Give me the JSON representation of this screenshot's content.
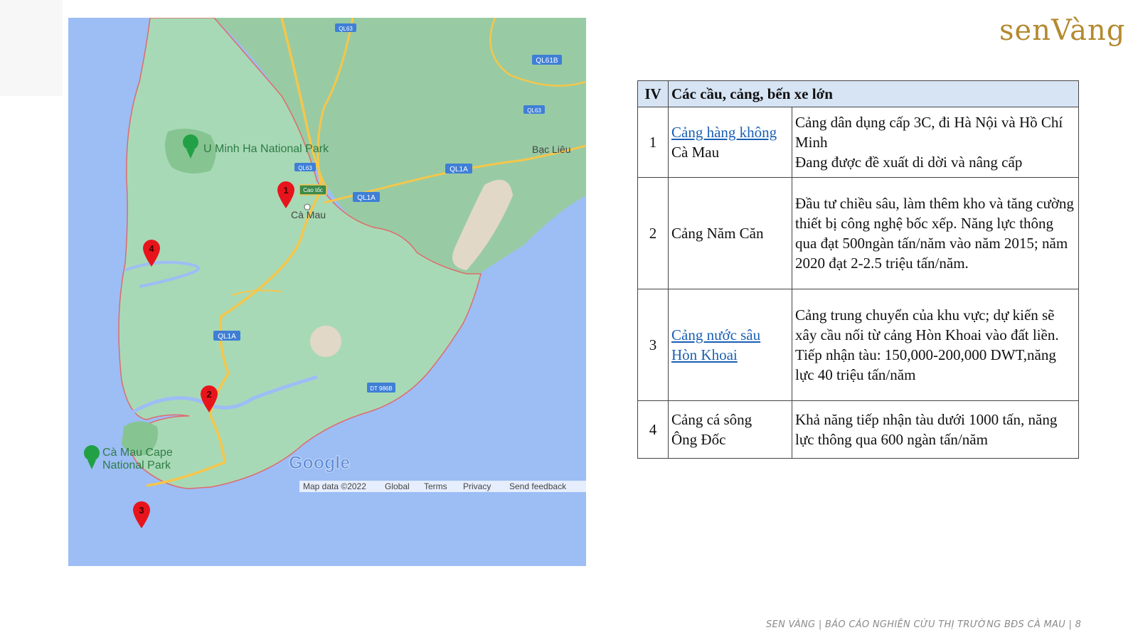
{
  "brand": {
    "name": "senVàng",
    "color": "#b38a2f"
  },
  "map": {
    "places": {
      "umh": "U Minh Ha National Park",
      "camau": "Cà Mau",
      "baclieu": "Bạc Liêu",
      "cape1": "Cà Mau Cape",
      "cape2": "National Park"
    },
    "roads": {
      "ql63a": "QL63",
      "ql63b": "QL63",
      "ql63c": "QL63",
      "ql61b": "QL61B",
      "ql1a_a": "QL1A",
      "ql1a_b": "QL1A",
      "ql1a_c": "QL1A",
      "dt986b": "DT 986B",
      "caotoc": "Cao tốc"
    },
    "markers": [
      {
        "n": "1"
      },
      {
        "n": "2"
      },
      {
        "n": "3"
      },
      {
        "n": "4"
      }
    ],
    "logo": "Google",
    "attribution": {
      "mapdata": "Map data ©2022",
      "global": "Global",
      "terms": "Terms",
      "privacy": "Privacy",
      "feedback": "Send feedback"
    },
    "colors": {
      "land": "#a8d9b6",
      "sea": "#9dbdf5",
      "marker": "#e8141c",
      "road": "#f5c64a"
    }
  },
  "table": {
    "header": {
      "num": "IV",
      "title": "Các cầu, cảng, bến xe lớn"
    },
    "rows": [
      {
        "num": "1",
        "name_link": "Cảng hàng không",
        "name_rest": "Cà Mau",
        "desc1": "Cảng dân dụng cấp 3C, đi Hà Nội và Hồ Chí Minh",
        "desc2": "Đang được đề xuất di dời và nâng cấp"
      },
      {
        "num": "2",
        "name": "Cảng Năm Căn",
        "desc": "Đầu tư chiều sâu, làm thêm kho và tăng cường thiết bị công nghệ bốc xếp. Năng lực thông qua đạt 500ngàn tấn/năm vào năm 2015; năm 2020 đạt 2-2.5 triệu tấn/năm."
      },
      {
        "num": "3",
        "name_link1": "Cảng nước sâu",
        "name_link2": "Hòn Khoai",
        "desc": "Cảng trung chuyển của khu vực; dự kiến sẽ xây cầu nối từ cảng Hòn Khoai vào đất liền.  Tiếp nhận tàu: 150,000-200,000 DWT,năng lực 40 triệu tấn/năm"
      },
      {
        "num": "4",
        "name1": "Cảng cá sông",
        "name2": "Ông Đốc",
        "desc": "Khả năng tiếp nhận tàu dưới 1000 tấn, năng lực thông qua 600 ngàn tấn/năm"
      }
    ]
  },
  "footer": "SEN VÀNG | BÁO CÁO NGHIÊN CỨU THỊ TRƯỜNG BĐS CÀ MAU | 8"
}
